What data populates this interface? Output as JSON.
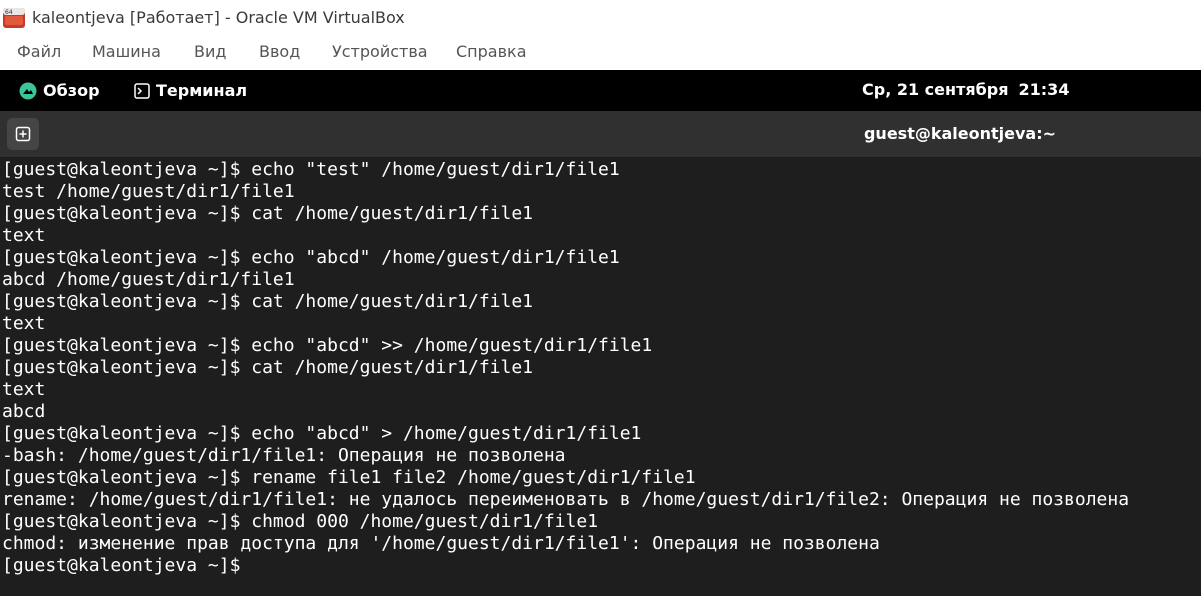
{
  "host_window": {
    "title": "kaleontjeva [Работает] - Oracle VM VirtualBox",
    "menu": [
      "Файл",
      "Машина",
      "Вид",
      "Ввод",
      "Устройства",
      "Справка"
    ]
  },
  "guest_topbar": {
    "activities_label": "Обзор",
    "app_label": "Терминал",
    "date": "Ср, 21 сентября",
    "time": "21:34"
  },
  "terminal": {
    "title": "guest@kaleontjeva:~",
    "lines": [
      "[guest@kaleontjeva ~]$ echo \"test\" /home/guest/dir1/file1",
      "test /home/guest/dir1/file1",
      "[guest@kaleontjeva ~]$ cat /home/guest/dir1/file1",
      "text",
      "[guest@kaleontjeva ~]$ echo \"abcd\" /home/guest/dir1/file1",
      "abcd /home/guest/dir1/file1",
      "[guest@kaleontjeva ~]$ cat /home/guest/dir1/file1",
      "text",
      "[guest@kaleontjeva ~]$ echo \"abcd\" >> /home/guest/dir1/file1",
      "[guest@kaleontjeva ~]$ cat /home/guest/dir1/file1",
      "text",
      "abcd",
      "[guest@kaleontjeva ~]$ echo \"abcd\" > /home/guest/dir1/file1",
      "-bash: /home/guest/dir1/file1: Операция не позволена",
      "[guest@kaleontjeva ~]$ rename file1 file2 /home/guest/dir1/file1",
      "rename: /home/guest/dir1/file1: не удалось переименовать в /home/guest/dir1/file2: Операция не позволена",
      "[guest@kaleontjeva ~]$ chmod 000 /home/guest/dir1/file1",
      "chmod: изменение прав доступа для '/home/guest/dir1/file1': Операция не позволена",
      "[guest@kaleontjeva ~]$"
    ]
  },
  "icons": {
    "app_icon": "virtualbox-icon",
    "activities_icon": "gnome-logo-icon",
    "terminal_app_icon": "terminal-icon",
    "new_tab_icon": "new-tab-icon"
  },
  "colors": {
    "terminal_background": "#1e1e1e",
    "terminal_text": "#ffffff",
    "topbar_background": "#000000",
    "header_background": "#303030",
    "gnome_logo_accent": "#3ec49b"
  }
}
